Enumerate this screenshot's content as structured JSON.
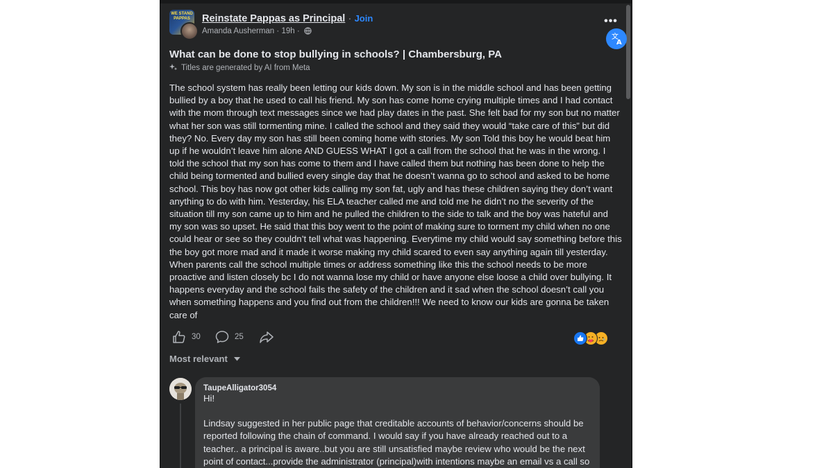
{
  "post": {
    "group_name": "Reinstate Pappas as Principal",
    "separator": "·",
    "join_label": "Join",
    "group_logo_text": "WE STAND PAPPAS",
    "author": "Amanda Ausherman",
    "time": "19h",
    "title": "What can be done to stop bullying in schools? | Chambersburg, PA",
    "ai_note": "Titles are generated by AI from Meta",
    "body": "The school system has really been letting our kids down. My son is in the middle school and has been getting bullied by a boy that he used to call his friend. My son has come home crying multiple times and I had contact with the mom through text messages since we had play dates in the past. She felt bad for my son but no matter  what her son was still tormenting mine. I called the school and they said they would “take care of this” but did they? No. Every day my son has still been coming home with stories. My son Told this boy he would beat him up if he wouldn’t leave him alone AND GUESS WHAT I got a call from the school that he was in the wrong. I told the school that my son has come to them and I have called them but nothing has been done to help the child being tormented and bullied every single day that he doesn’t wanna go to school and asked to be home school. This boy has now got other kids calling my son fat, ugly and has these children saying they don’t want anything to do with him. Yesterday, his ELA teacher called me and told me he didn’t no the severity of the situation till my son came up to him and he pulled the children to the side to talk and the boy was hateful and my son was so upset. He said that this boy went to the point of making sure to torment my child when no one could hear or see so they couldn’t tell what was happening. Everytime my child would say something before this the boy got more mad and it made it worse making my child scared to even say anything again till yesterday. When parents call the school multiple times or address something like this the school needs to be more proactive and listen closely bc I do not wanna lose my child or have anyone else loose a child over bullying. It happens everyday and the school fails the safety of the children and it sad when the school doesn’t call you when something happens and you find out from the children!!! We need to know our kids are gonna be taken care of",
    "likes": "30",
    "comments": "25"
  },
  "icons": {
    "more": "more-options-icon",
    "translate": "translate-icon",
    "globe": "globe-icon",
    "sparkle": "ai-sparkle-icon",
    "like": "thumbs-up-icon",
    "comment": "comment-bubble-icon",
    "share": "share-arrow-icon",
    "reactions": [
      "like-reaction",
      "care-reaction",
      "sad-reaction"
    ]
  },
  "colors": {
    "background": "#242526",
    "text": "#e4e6eb",
    "secondary_text": "#b0b3b8",
    "accent": "#2d88ff",
    "comment_bubble": "#3a3b3c"
  },
  "sort": {
    "label": "Most relevant"
  },
  "comment": {
    "author": "TaupeAlligator3054",
    "text": "Hi!\n\nLindsay suggested in her public page that creditable accounts of behavior/concerns should be reported following the chain of command. I would say if you have already reached out to a teacher.. a principal is aware..but you are still unsatisfied maybe review who would be the next point of contact...provide the administrator (principal)with intentions maybe an email vs a call so you have documentation as you moving this to the next necessary level of"
  }
}
